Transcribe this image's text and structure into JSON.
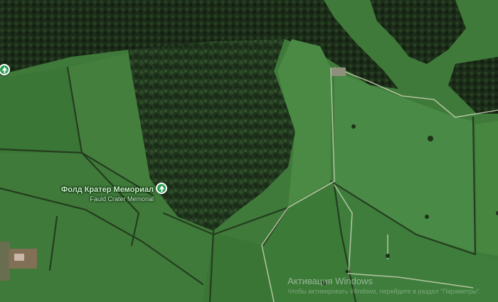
{
  "map": {
    "type": "satellite",
    "colors": {
      "field": "#3f7a3a",
      "field_light": "#4d8c45",
      "forest": "#243a20",
      "forest_dark": "#172615",
      "track": "#bfc9a7",
      "hedge": "#26401f",
      "poi_green": "#2e9e55"
    }
  },
  "pois": [
    {
      "id": "fauld",
      "label_ru": "Фолд Кратер Мемориал",
      "label_en": "Fauld Crater Memorial",
      "icon": "tree-icon"
    },
    {
      "id": "edge",
      "label_ru": "",
      "label_en": "",
      "icon": "tree-icon"
    }
  ],
  "watermark": {
    "title": "Активация Windows",
    "subtitle": "Чтобы активировать Windows, перейдите в раздел \"Параметры\"."
  }
}
